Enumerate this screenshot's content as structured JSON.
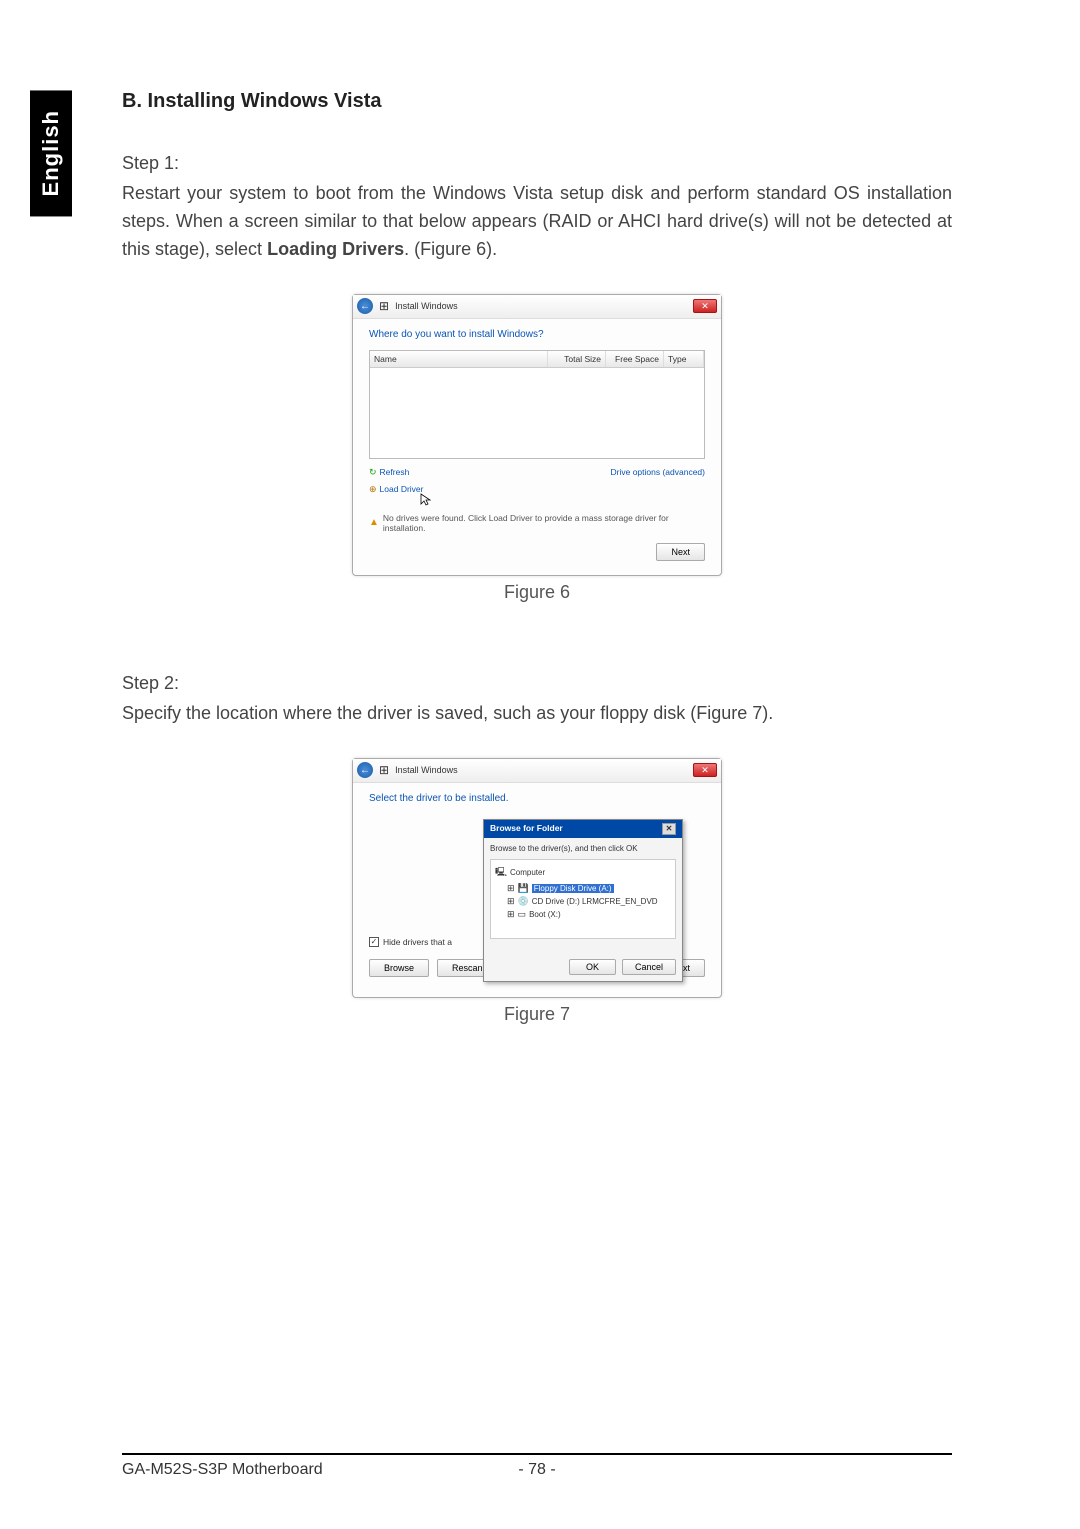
{
  "sideTab": "English",
  "sectionTitle": "B. Installing Windows Vista",
  "step1": {
    "label": "Step 1:",
    "text_pre": "Restart your system to boot from the Windows Vista setup disk and perform standard OS installation steps. When a screen similar to that below appears (RAID or AHCI hard drive(s) will not be detected at this stage), select ",
    "text_bold": "Loading Drivers",
    "text_post": ". (Figure 6)."
  },
  "figure6": {
    "caption": "Figure 6",
    "window": {
      "title": "Install Windows",
      "heading": "Where do you want to install Windows?",
      "columns": {
        "name": "Name",
        "totalSize": "Total Size",
        "freeSpace": "Free Space",
        "type": "Type"
      },
      "refresh": "Refresh",
      "driveOptions": "Drive options (advanced)",
      "loadDriver": "Load Driver",
      "warning": "No drives were found. Click Load Driver to provide a mass storage driver for installation.",
      "next": "Next"
    }
  },
  "step2": {
    "label": "Step 2:",
    "text": "Specify the location where the driver is saved, such as your floppy disk (Figure 7)."
  },
  "figure7": {
    "caption": "Figure 7",
    "window": {
      "title": "Install Windows",
      "heading": "Select the driver to be installed.",
      "hideDrivers": "Hide drivers that a",
      "browse": "Browse",
      "rescan": "Rescan",
      "next": "Next"
    },
    "dialog": {
      "title": "Browse for Folder",
      "instruction": "Browse to the driver(s), and then click OK",
      "tree": {
        "root": "Computer",
        "items": [
          "Floppy Disk Drive (A:)",
          "CD Drive (D:) LRMCFRE_EN_DVD",
          "Boot (X:)"
        ]
      },
      "ok": "OK",
      "cancel": "Cancel"
    }
  },
  "footer": {
    "model": "GA-M52S-S3P Motherboard",
    "page": "- 78 -"
  }
}
